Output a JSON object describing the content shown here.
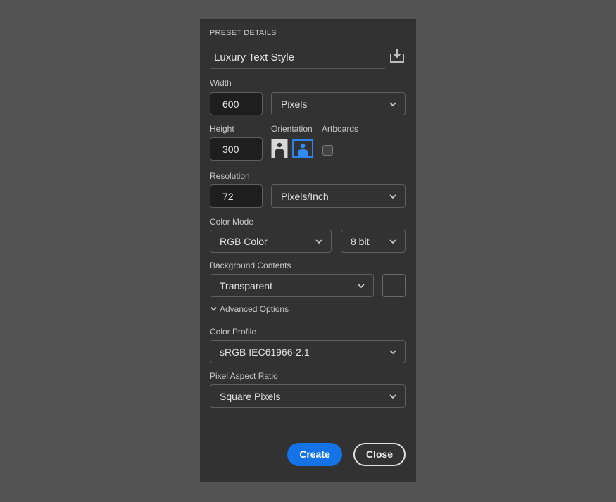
{
  "panel": {
    "section_title": "PRESET DETAILS",
    "preset_name": "Luxury Text Style",
    "save_icon": "save-preset-icon"
  },
  "width": {
    "label": "Width",
    "value": "600",
    "unit": "Pixels"
  },
  "height": {
    "label": "Height",
    "value": "300"
  },
  "orientation": {
    "label": "Orientation",
    "selected": "landscape"
  },
  "artboards": {
    "label": "Artboards",
    "checked": false
  },
  "resolution": {
    "label": "Resolution",
    "value": "72",
    "unit": "Pixels/Inch"
  },
  "color_mode": {
    "label": "Color Mode",
    "mode": "RGB Color",
    "depth": "8 bit"
  },
  "background": {
    "label": "Background Contents",
    "value": "Transparent"
  },
  "advanced": {
    "label": "Advanced Options",
    "expanded": true
  },
  "color_profile": {
    "label": "Color Profile",
    "value": "sRGB IEC61966-2.1"
  },
  "pixel_aspect": {
    "label": "Pixel Aspect Ratio",
    "value": "Square Pixels"
  },
  "buttons": {
    "create": "Create",
    "close": "Close"
  },
  "colors": {
    "accent": "#1473e6",
    "panel_bg": "#323232",
    "page_bg": "#535353"
  }
}
